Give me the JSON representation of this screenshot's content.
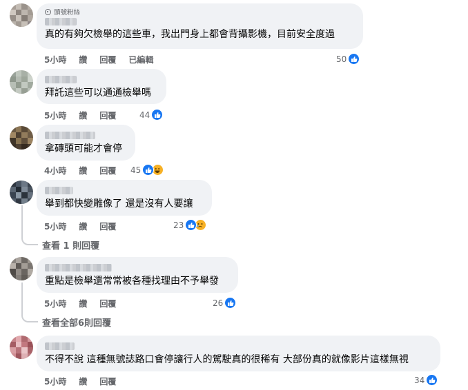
{
  "comments": [
    {
      "badge": "頭號粉絲",
      "text": "真的有夠欠檢舉的這些車，我出門身上都會背攝影機，目前安全度過",
      "time": "5小時",
      "like": "讚",
      "reply": "回覆",
      "edited": "已編輯",
      "count": "50",
      "reactions": [
        "like"
      ]
    },
    {
      "text": "拜託這些可以通通檢舉嗎",
      "time": "5小時",
      "like": "讚",
      "reply": "回覆",
      "count": "44",
      "reactions": [
        "like"
      ]
    },
    {
      "text": "拿磚頭可能才會停",
      "time": "4小時",
      "like": "讚",
      "reply": "回覆",
      "count": "45",
      "reactions": [
        "like",
        "haha"
      ]
    },
    {
      "text": "舉到都快變雕像了 還是沒有人要讓",
      "time": "5小時",
      "like": "讚",
      "reply": "回覆",
      "count": "23",
      "reactions": [
        "like",
        "sad"
      ],
      "view_replies": "查看 1 則回覆"
    },
    {
      "text": "重點是檢舉還常常被各種找理由不予舉發",
      "time": "5小時",
      "like": "讚",
      "reply": "回覆",
      "count": "26",
      "reactions": [
        "like"
      ],
      "view_replies": "查看全部6則回覆"
    },
    {
      "text": "不得不說 這種無號誌路口會停讓行人的駕駛真的很稀有 大部份真的就像影片這樣無視",
      "time": "5小時",
      "like": "讚",
      "reply": "回覆",
      "count": "34",
      "reactions": [
        "like"
      ]
    }
  ],
  "colors": {
    "like_blue": "#1877f2",
    "bubble": "#f0f2f5",
    "meta": "#65676b"
  }
}
